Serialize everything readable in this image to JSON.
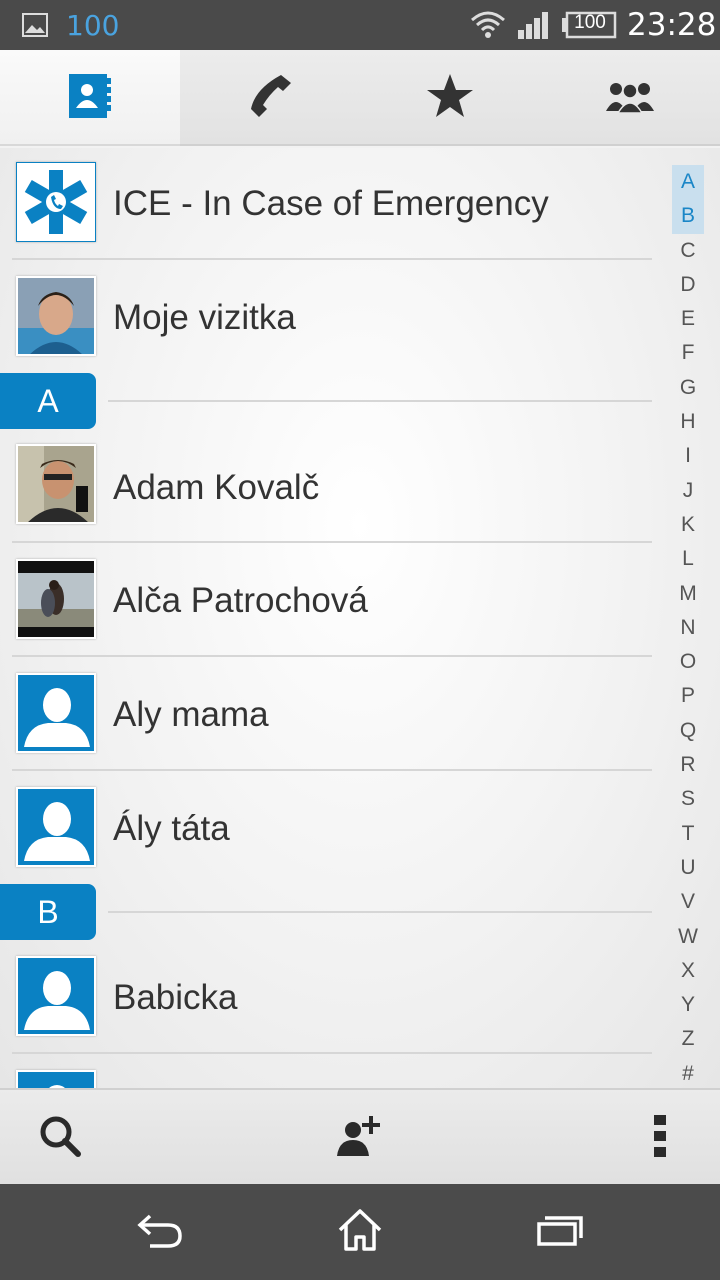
{
  "status_bar": {
    "notification_count": "100",
    "battery": "100",
    "time": "23:28",
    "icons": [
      "image-notification-icon",
      "wifi-icon",
      "signal-icon",
      "battery-icon"
    ]
  },
  "tabs": [
    {
      "icon": "contacts-book-icon",
      "active": true
    },
    {
      "icon": "phone-icon",
      "active": false
    },
    {
      "icon": "star-icon",
      "active": false
    },
    {
      "icon": "groups-icon",
      "active": false
    }
  ],
  "contacts": {
    "ice": "ICE - In Case of Emergency",
    "my_card": "Moje vizitka",
    "section_a": "A",
    "section_b": "B",
    "items": [
      "Adam Kovalč",
      "Alča Patrochová",
      "Aly mama",
      "Ály táta",
      "Babicka"
    ]
  },
  "alphabet_index": [
    "A",
    "B",
    "C",
    "D",
    "E",
    "F",
    "G",
    "H",
    "I",
    "J",
    "K",
    "L",
    "M",
    "N",
    "O",
    "P",
    "Q",
    "R",
    "S",
    "T",
    "U",
    "V",
    "W",
    "X",
    "Y",
    "Z",
    "#"
  ],
  "actions": {
    "icons": [
      "search-icon",
      "add-contact-icon",
      "overflow-menu-icon"
    ]
  },
  "navigation": {
    "icons": [
      "back-icon",
      "home-icon",
      "recents-icon"
    ]
  },
  "colors": {
    "accent": "#0a81c3",
    "status_bar": "#4a4a4a",
    "nav_bar": "#4b4b4b",
    "index_highlight": "#c9dfee"
  }
}
